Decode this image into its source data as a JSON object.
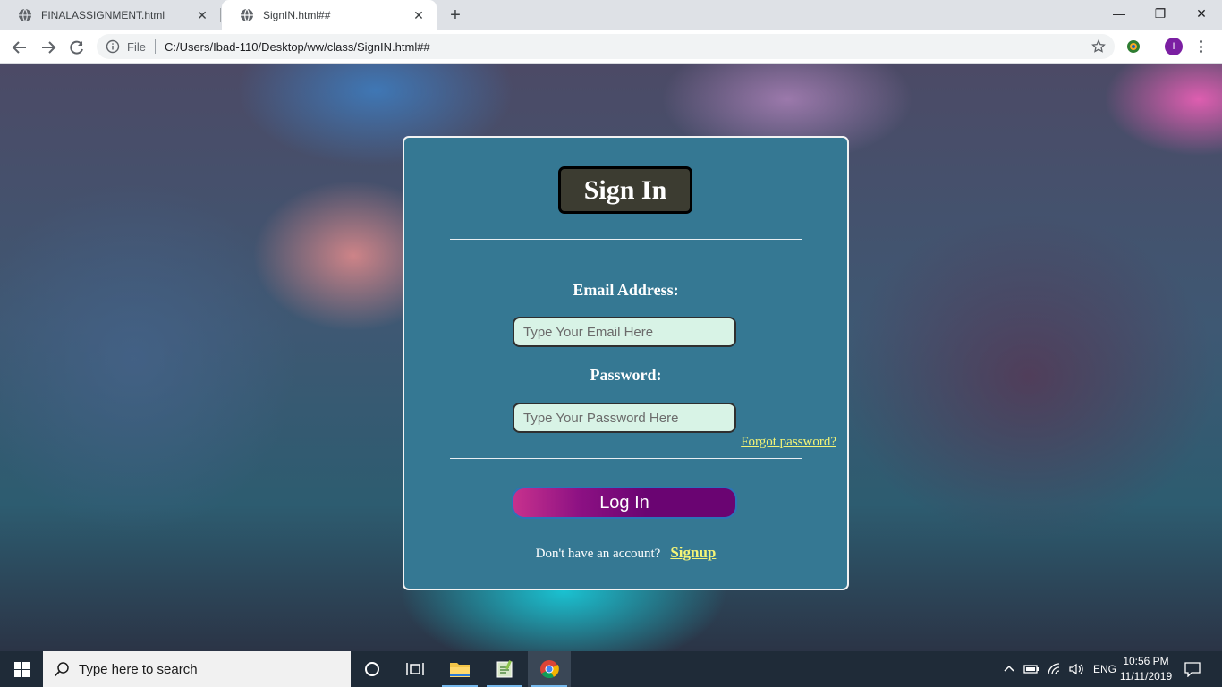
{
  "browser": {
    "tabs": [
      {
        "title": "FINALASSIGNMENT.html",
        "close": "✕"
      },
      {
        "title": "SignIN.html##",
        "close": "✕"
      }
    ],
    "new_tab": "+",
    "window_controls": {
      "minimize": "—",
      "restore": "❐",
      "close": "✕"
    },
    "omnibox": {
      "scheme_label": "File",
      "url": "C:/Users/Ibad-110/Desktop/ww/class/SignIN.html##"
    },
    "profile_initial": "I",
    "icons": [
      "back-icon",
      "forward-icon",
      "reload-icon",
      "info-icon",
      "star-icon",
      "extension-icon",
      "menu-icon"
    ]
  },
  "signin": {
    "title": "Sign In",
    "email_label": "Email Address:",
    "email_placeholder": "Type Your Email Here",
    "email_value": "",
    "password_label": "Password:",
    "password_placeholder": "Type Your Password Here",
    "password_value": "",
    "forgot_link": "Forgot password?",
    "login_button": "Log In",
    "no_account_text": "Don't have an account?",
    "signup_link": "Signup",
    "colors": {
      "card": "#357893",
      "title_bg": "#3c3c31",
      "input_bg": "#d8f3e6",
      "link": "#f5f576",
      "button_start": "#c7318d",
      "button_end": "#6a0472"
    }
  },
  "taskbar": {
    "search_placeholder": "Type here to search",
    "apps": [
      "cortana-icon",
      "task-view-icon",
      "file-explorer-icon",
      "notepad-icon",
      "chrome-icon"
    ],
    "language": "ENG",
    "time": "10:56 PM",
    "date": "11/11/2019"
  }
}
